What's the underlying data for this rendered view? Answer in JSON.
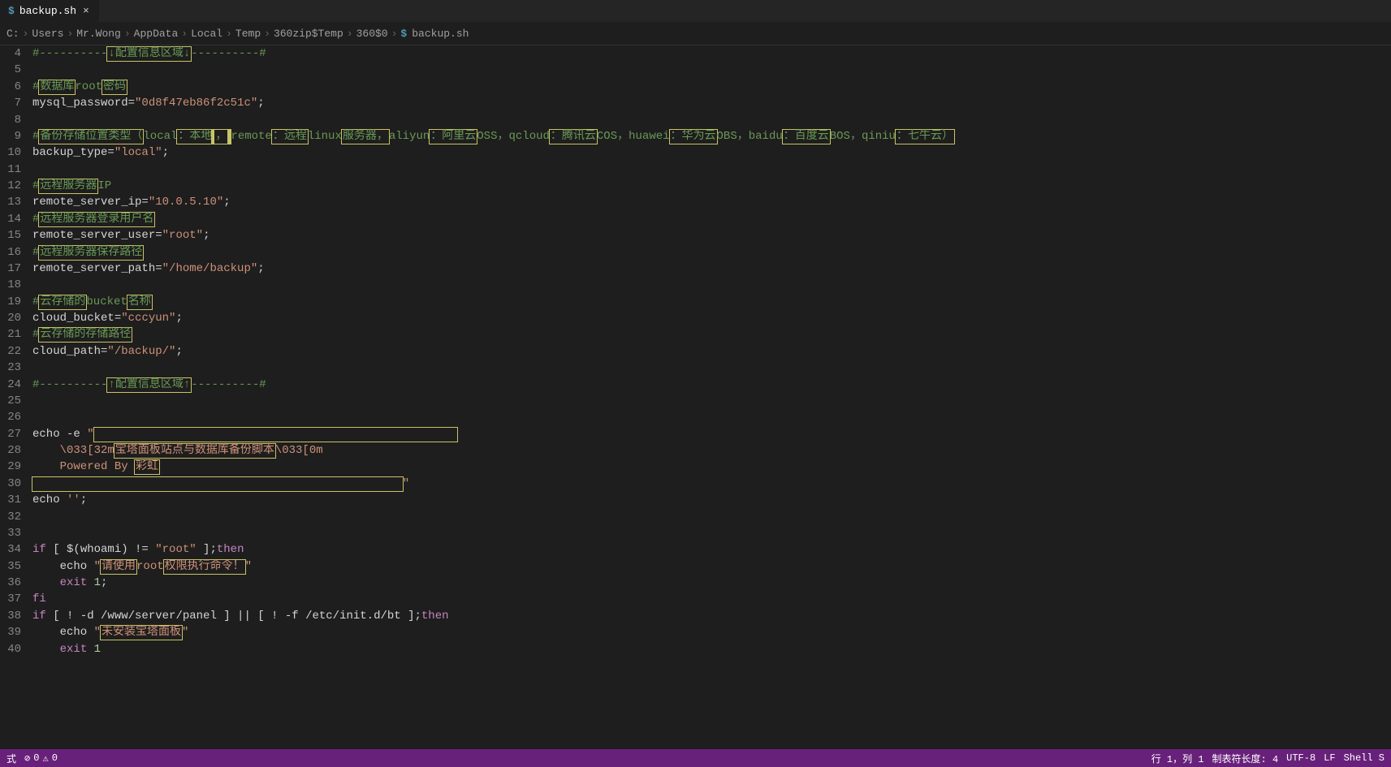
{
  "tab": {
    "icon": "$",
    "label": "backup.sh",
    "close": "×"
  },
  "breadcrumb": [
    "C:",
    "Users",
    "Mr.Wong",
    "AppData",
    "Local",
    "Temp",
    "360zip$Temp",
    "360$0"
  ],
  "breadcrumb_file": {
    "icon": "$",
    "name": "backup.sh"
  },
  "breadcrumb_sep": "›",
  "lines": {
    "start": 4,
    "rows": [
      {
        "n": 4,
        "t": "comment",
        "txt": "#----------↓配置信息区域↓----------#",
        "hl": "↓配置信息区域↓"
      },
      {
        "n": 5,
        "t": "blank"
      },
      {
        "n": 6,
        "t": "comment",
        "txt": "#数据库root密码",
        "hls": [
          "数据库",
          "密码"
        ]
      },
      {
        "n": 7,
        "t": "assign",
        "var": "mysql_password",
        "val": "\"0d8f47eb86f2c51c\""
      },
      {
        "n": 8,
        "t": "blank"
      },
      {
        "n": 9,
        "t": "comment",
        "txt": "#备份存储位置类型（local：本地，remote：远程linux服务器，aliyun：阿里云OSS，qcloud：腾讯云COS，huawei：华为云OBS，baidu：百度云BOS，qiniu：七牛云）",
        "hls": [
          "备份存储位置类型（",
          "：本地，",
          "：远程",
          "服务器，",
          "：阿里云",
          "，",
          "：腾讯云",
          "，",
          "：华为云",
          "，",
          "：百度云",
          "，",
          "：七牛云）"
        ]
      },
      {
        "n": 10,
        "t": "assign",
        "var": "backup_type",
        "val": "\"local\""
      },
      {
        "n": 11,
        "t": "blank"
      },
      {
        "n": 12,
        "t": "comment",
        "txt": "#远程服务器IP",
        "hls": [
          "远程服务器"
        ]
      },
      {
        "n": 13,
        "t": "assign",
        "var": "remote_server_ip",
        "val": "\"10.0.5.10\""
      },
      {
        "n": 14,
        "t": "comment",
        "txt": "#远程服务器登录用户名",
        "hls": [
          "远程服务器登录用户名"
        ]
      },
      {
        "n": 15,
        "t": "assign",
        "var": "remote_server_user",
        "val": "\"root\""
      },
      {
        "n": 16,
        "t": "comment",
        "txt": "#远程服务器保存路径",
        "hls": [
          "远程服务器保存路径"
        ]
      },
      {
        "n": 17,
        "t": "assign",
        "var": "remote_server_path",
        "val": "\"/home/backup\""
      },
      {
        "n": 18,
        "t": "blank"
      },
      {
        "n": 19,
        "t": "comment",
        "txt": "#云存储的bucket名称",
        "hls": [
          "云存储的",
          "名称"
        ]
      },
      {
        "n": 20,
        "t": "assign",
        "var": "cloud_bucket",
        "val": "\"cccyun\""
      },
      {
        "n": 21,
        "t": "comment",
        "txt": "#云存储的存储路径",
        "hls": [
          "云存储的存储路径"
        ]
      },
      {
        "n": 22,
        "t": "assign",
        "var": "cloud_path",
        "val": "\"/backup/\""
      },
      {
        "n": 23,
        "t": "blank"
      },
      {
        "n": 24,
        "t": "comment",
        "txt": "#----------↑配置信息区域↑----------#",
        "hl": "↑配置信息区域↑"
      },
      {
        "n": 25,
        "t": "blank"
      },
      {
        "n": 26,
        "t": "blank"
      },
      {
        "n": 27,
        "t": "raw",
        "html": "echo -e <span class='c-string'>\"<span class='hl'>                                                     </span></span>"
      },
      {
        "n": 28,
        "t": "raw",
        "html": "<span class='c-string'>    \\033[32m<span class='hl'>宝塔面板站点与数据库备份脚本</span>\\033[0m</span>"
      },
      {
        "n": 29,
        "t": "raw",
        "html": "<span class='c-string'>    Powered By <span class='hl'>彩虹</span></span>"
      },
      {
        "n": 30,
        "t": "raw",
        "html": "<span class='c-string'><span class='hl'>                                                      </span>\"</span>"
      },
      {
        "n": 31,
        "t": "raw",
        "html": "echo <span class='c-string'>''</span>;"
      },
      {
        "n": 32,
        "t": "blank"
      },
      {
        "n": 33,
        "t": "blank"
      },
      {
        "n": 34,
        "t": "raw",
        "html": "<span class='c-kw'>if</span> [ $(whoami) != <span class='c-string'>\"root\"</span> ];<span class='c-kw'>then</span>"
      },
      {
        "n": 35,
        "t": "raw",
        "html": "    echo <span class='c-string'>\"<span class='hl'>请使用</span>root<span class='hl'>权限执行命令！</span>\"</span>"
      },
      {
        "n": 36,
        "t": "raw",
        "html": "    <span class='c-kw'>exit</span> <span class='c-num'>1</span>;"
      },
      {
        "n": 37,
        "t": "raw",
        "html": "<span class='c-kw'>fi</span>"
      },
      {
        "n": 38,
        "t": "raw",
        "html": "<span class='c-kw'>if</span> [ ! -d /www/server/panel ] || [ ! -f /etc/init.d/bt ];<span class='c-kw'>then</span>"
      },
      {
        "n": 39,
        "t": "raw",
        "html": "    echo <span class='c-string'>\"<span class='hl'>未安装宝塔面板</span>\"</span>"
      },
      {
        "n": 40,
        "t": "raw",
        "html": "    <span class='c-kw'>exit</span> <span class='c-num'>1</span>"
      }
    ]
  },
  "status": {
    "left_prefix": "式",
    "errors": "0",
    "warnings": "0",
    "cursor": "行 1，列 1",
    "tabsize": "制表符长度: 4",
    "encoding": "UTF-8",
    "eol": "LF",
    "lang": "Shell S"
  }
}
